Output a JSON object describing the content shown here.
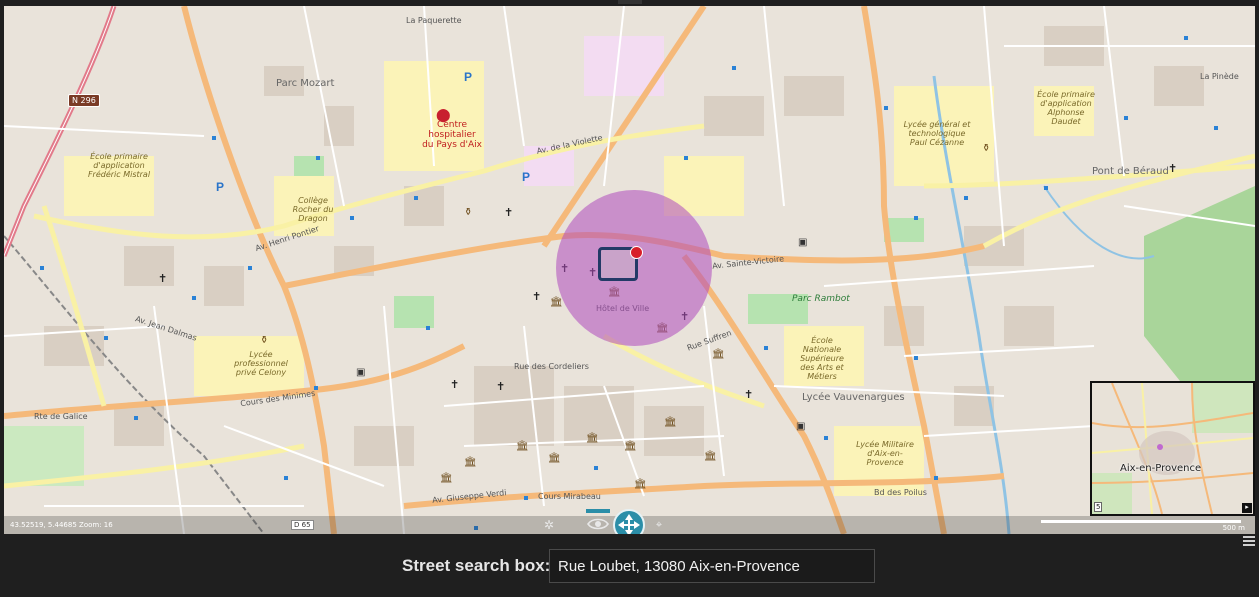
{
  "map": {
    "coordinates": "43.52519, 5.44685",
    "zoom_text": "Zoom: 16",
    "scale_label": "500 m",
    "road_ref": "D 65",
    "shields": {
      "n296": "N 296"
    },
    "labels": {
      "parc_mozart": "Parc Mozart",
      "hospital": "Centre hospitalier du Pays d'Aix",
      "pont_de_beraud": "Pont de Béraud",
      "lycee_cezanne": "Lycée général et technologique Paul Cézanne",
      "ecole_frederic_mistral": "École primaire d'application Frédéric Mistral",
      "college_rocher": "Collège Rocher du Dragon",
      "ecole_daudet": "École primaire d'application Alphonse Daudet",
      "lycee_celony": "Lycée professionnel privé Celony",
      "lycee_vauvenargues": "Lycée Vauvenargues",
      "lycee_militaire": "Lycée Militaire d'Aix-en-Provence",
      "ecole_arts": "École Nationale Supérieure des Arts et Métiers",
      "parc_rambot": "Parc Rambot",
      "la_pinede": "La Pinède",
      "la_paquerette": "La Paquerette",
      "av_violette": "Av. de la Violette",
      "av_henri_pontier": "Av. Henri Pontier",
      "av_sainte_victoire": "Av. Sainte-Victoire",
      "rte_de_galice": "Rte de Galice",
      "cours_des_minimes": "Cours des Minimes",
      "cours_mirabeau": "Cours Mirabeau",
      "bd_des_poilus": "Bd des Poilus",
      "av_jean_dalmas": "Av. Jean Dalmas",
      "av_giuseppe_verdi": "Av. Giuseppe Verdi",
      "rue_des_cordeliers": "Rue des Cordeliers",
      "hotel_de_ville": "Hôtel de Ville",
      "rue_suffren": "Rue Suffren",
      "pont_de_beraud_small": "Pont de Béraud"
    }
  },
  "minimap": {
    "label": "Aix-en-Provence",
    "zoom_badge": "5"
  },
  "search": {
    "label": "Street search box:",
    "value": "Rue Loubet, 13080 Aix-en-Provence"
  }
}
